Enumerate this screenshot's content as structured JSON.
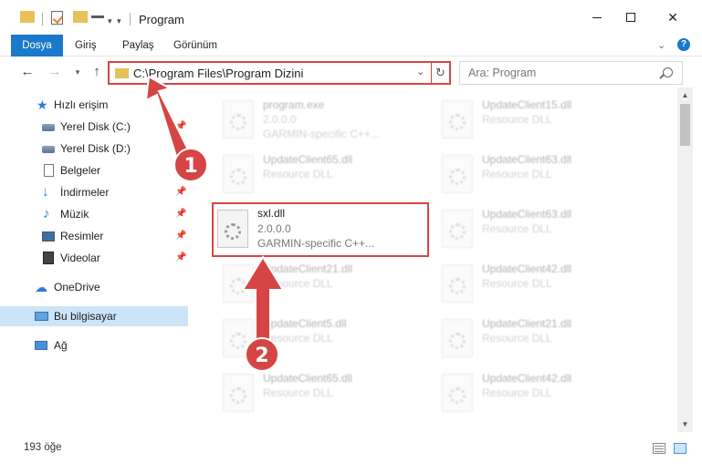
{
  "window": {
    "title": "Program"
  },
  "ribbon": {
    "tabs": [
      "Dosya",
      "Giriş",
      "Paylaş",
      "Görünüm"
    ]
  },
  "nav": {
    "address": "C:\\Program Files\\Program Dizini",
    "search_placeholder": "Ara: Program"
  },
  "sidebar": {
    "items": [
      {
        "label": "Hızlı erişim",
        "icon": "star-icon"
      },
      {
        "label": "Yerel Disk (C:)",
        "icon": "drive-icon"
      },
      {
        "label": "Yerel Disk (D:)",
        "icon": "drive-icon"
      },
      {
        "label": "Belgeler",
        "icon": "document-icon"
      },
      {
        "label": "İndirmeler",
        "icon": "download-icon"
      },
      {
        "label": "Müzik",
        "icon": "music-icon"
      },
      {
        "label": "Resimler",
        "icon": "pictures-icon"
      },
      {
        "label": "Videolar",
        "icon": "video-icon"
      },
      {
        "label": "OneDrive",
        "icon": "cloud-icon"
      },
      {
        "label": "Bu bilgisayar",
        "icon": "computer-icon"
      },
      {
        "label": "Ağ",
        "icon": "network-icon"
      }
    ]
  },
  "files": [
    {
      "name": "program.exe",
      "line2": "2.0.0.0",
      "line3": "GARMIN-specific C++..."
    },
    {
      "name": "UpdateClient15.dll",
      "line2": "Resource DLL",
      "line3": ""
    },
    {
      "name": "UpdateClient65.dll",
      "line2": "Resource DLL",
      "line3": ""
    },
    {
      "name": "UpdateClient63.dll",
      "line2": "Resource DLL",
      "line3": ""
    },
    {
      "name": "sxl.dll",
      "line2": "2.0.0.0",
      "line3": "GARMIN-specific C++..."
    },
    {
      "name": "UpdateClient63.dll",
      "line2": "Resource DLL",
      "line3": ""
    },
    {
      "name": "UpdateClient21.dll",
      "line2": "Resource DLL",
      "line3": ""
    },
    {
      "name": "UpdateClient42.dll",
      "line2": "Resource DLL",
      "line3": ""
    },
    {
      "name": "UpdateClient5.dll",
      "line2": "Resource DLL",
      "line3": ""
    },
    {
      "name": "UpdateClient21.dll",
      "line2": "Resource DLL",
      "line3": ""
    },
    {
      "name": "UpdateClient65.dll",
      "line2": "Resource DLL",
      "line3": ""
    },
    {
      "name": "UpdateClient42.dll",
      "line2": "Resource DLL",
      "line3": ""
    }
  ],
  "status": {
    "count": "193 öğe"
  },
  "annotations": {
    "step1": "1",
    "step2": "2"
  },
  "colors": {
    "accent": "#1979ca",
    "highlight": "#d64545",
    "selected": "#cce4f7"
  }
}
